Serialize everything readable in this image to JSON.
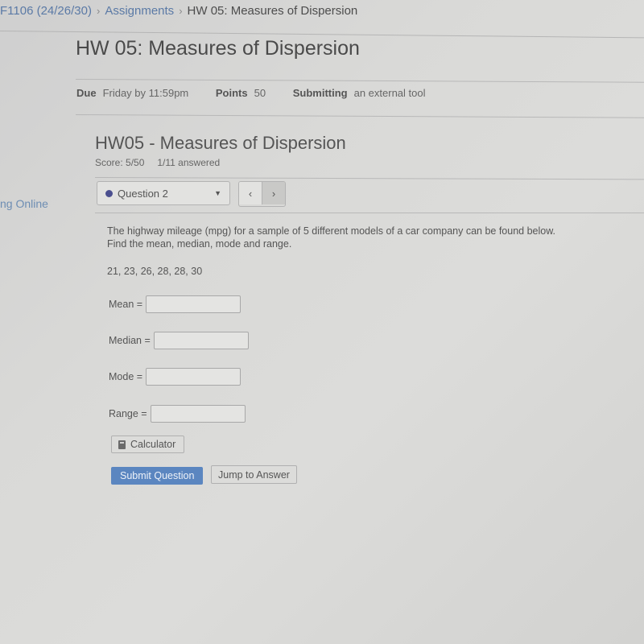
{
  "breadcrumb": {
    "course": "F1106 (24/26/30)",
    "section": "Assignments",
    "current": "HW 05: Measures of Dispersion",
    "separator": "›"
  },
  "page_title": "HW 05: Measures of Dispersion",
  "meta": {
    "due_label": "Due",
    "due_value": "Friday by 11:59pm",
    "points_label": "Points",
    "points_value": "50",
    "submitting_label": "Submitting",
    "submitting_value": "an external tool"
  },
  "sidebar": {
    "partial_link": "ng Online"
  },
  "assignment": {
    "title": "HW05 - Measures of Dispersion",
    "score": "Score: 5/50",
    "answered": "1/11 answered"
  },
  "question_nav": {
    "selected": "Question 2",
    "status_color": "#4b4f8f",
    "prev_icon": "chevron-left-icon",
    "next_icon": "chevron-right-icon",
    "prev_glyph": "‹",
    "next_glyph": "›",
    "caret_glyph": "▼"
  },
  "question": {
    "text": "The highway mileage (mpg) for a sample of 5 different models of a car company can be found below. Find the mean, median, mode and range.",
    "dataset": "21, 23, 26, 28, 28, 30",
    "fields": [
      {
        "label": "Mean =",
        "value": ""
      },
      {
        "label": "Median =",
        "value": ""
      },
      {
        "label": "Mode =",
        "value": ""
      },
      {
        "label": "Range =",
        "value": ""
      }
    ]
  },
  "buttons": {
    "calculator": "Calculator",
    "submit": "Submit Question",
    "jump": "Jump to Answer",
    "submit_color": "#5b86c0"
  }
}
